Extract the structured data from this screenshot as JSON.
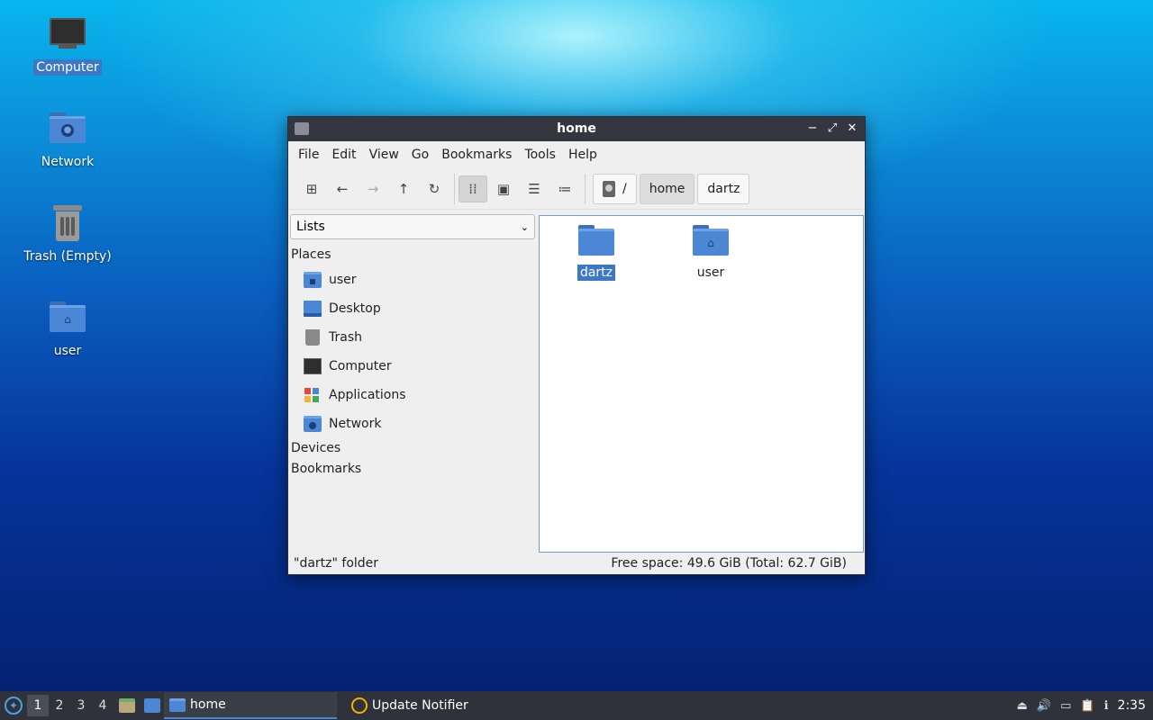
{
  "desktop": {
    "icons": [
      {
        "label": "Computer"
      },
      {
        "label": "Network"
      },
      {
        "label": "Trash (Empty)"
      },
      {
        "label": "user"
      }
    ]
  },
  "window": {
    "title": "home",
    "menu": [
      "File",
      "Edit",
      "View",
      "Go",
      "Bookmarks",
      "Tools",
      "Help"
    ],
    "breadcrumbs": [
      "/",
      "home",
      "dartz"
    ],
    "sidebar": {
      "combo": "Lists",
      "places_label": "Places",
      "places": [
        "user",
        "Desktop",
        "Trash",
        "Computer",
        "Applications",
        "Network"
      ],
      "devices_label": "Devices",
      "bookmarks_label": "Bookmarks"
    },
    "files": [
      {
        "name": "dartz"
      },
      {
        "name": "user"
      }
    ],
    "status": {
      "left": "\"dartz\" folder",
      "right": "Free space: 49.6 GiB (Total: 62.7 GiB)"
    }
  },
  "taskbar": {
    "workspaces": [
      "1",
      "2",
      "3",
      "4"
    ],
    "tasks": [
      "home",
      "Update Notifier"
    ],
    "clock": "2:35"
  },
  "colors": {
    "accent": "#3c78c8",
    "folder": "#4c87d6",
    "titlebar": "#343740",
    "taskbar": "#2f323a"
  }
}
